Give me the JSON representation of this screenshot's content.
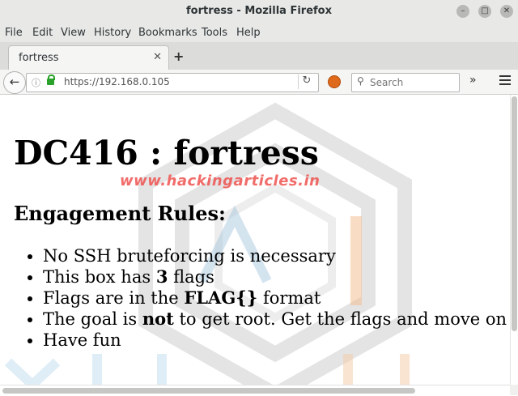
{
  "window": {
    "title": "fortress - Mozilla Firefox"
  },
  "menu": {
    "items": [
      "File",
      "Edit",
      "View",
      "History",
      "Bookmarks",
      "Tools",
      "Help"
    ]
  },
  "tab": {
    "label": "fortress",
    "close": "✕",
    "new_tab": "+"
  },
  "navbar": {
    "url": "https://192.168.0.105",
    "search_placeholder": "Search",
    "overflow": "»",
    "back": "←",
    "reload": "↻",
    "info": "ⓘ"
  },
  "page": {
    "heading": "DC416 : fortress",
    "subheading": "Engagement Rules:",
    "rules": [
      {
        "before": "No SSH bruteforcing is necessary",
        "bold": "",
        "after": ""
      },
      {
        "before": "This box has ",
        "bold": "3",
        "after": " flags"
      },
      {
        "before": "Flags are in the ",
        "bold": "FLAG{}",
        "after": " format"
      },
      {
        "before": "The goal is ",
        "bold": "not",
        "after": " to get root. Get the flags and move on"
      },
      {
        "before": "Have fun",
        "bold": "",
        "after": ""
      }
    ],
    "watermark": "www.hackingarticles.in"
  },
  "colors": {
    "watermark_text": "#ef5350",
    "lock": "#2aa12a",
    "chrome": "#e8e8e7"
  }
}
